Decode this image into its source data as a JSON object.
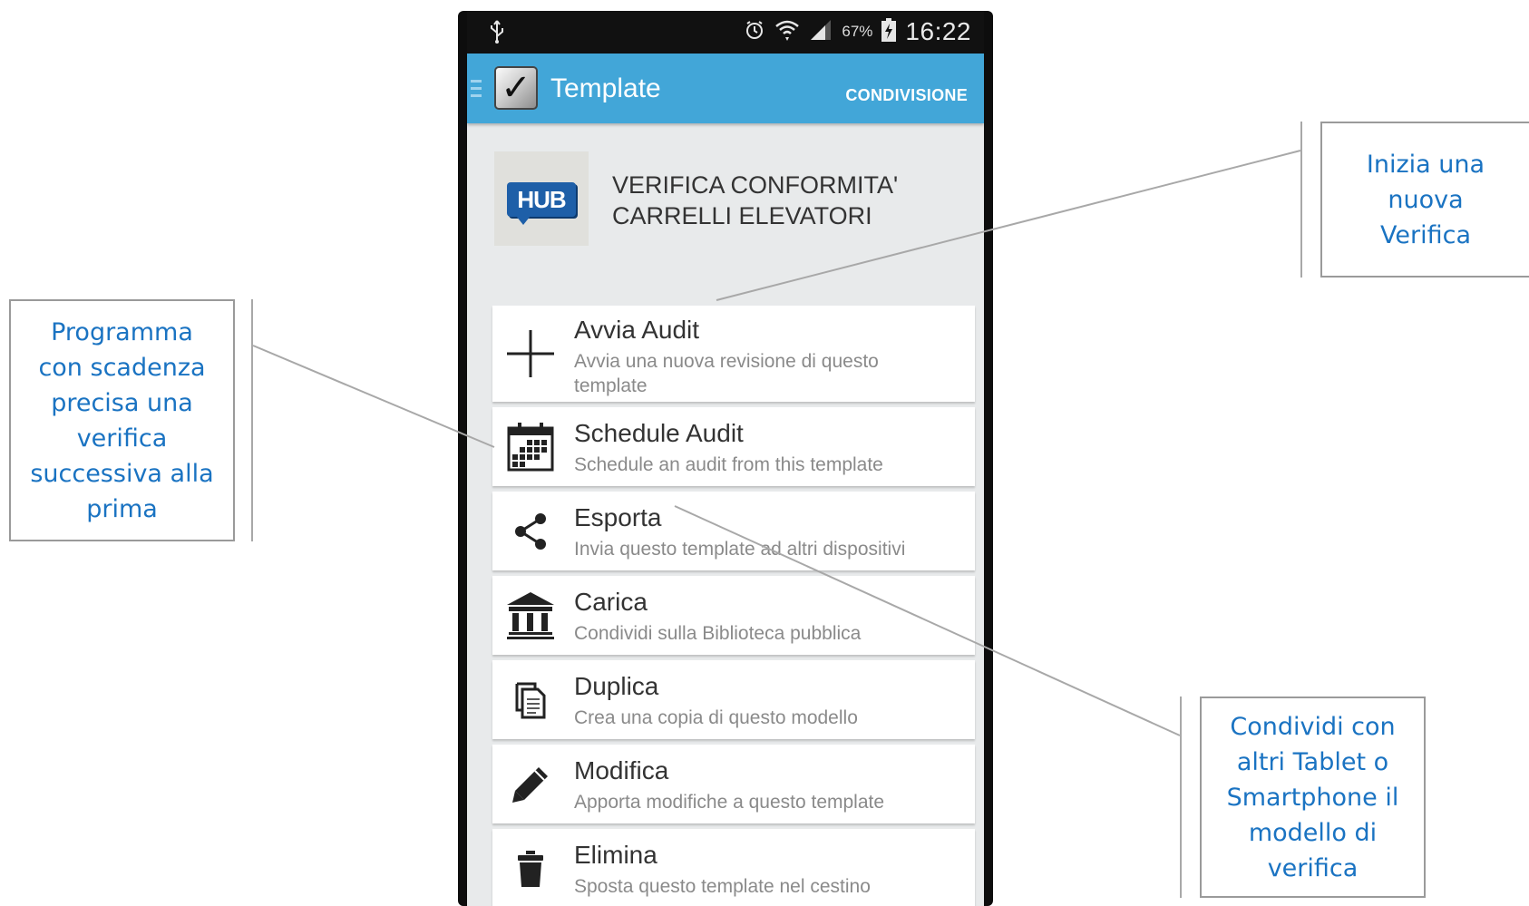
{
  "status_bar": {
    "usb_icon": "usb-icon",
    "alarm_icon": "alarm-icon",
    "wifi_icon": "wifi-icon",
    "signal_icon": "signal-icon",
    "battery_percent": "67%",
    "battery_icon": "battery-charging-icon",
    "time": "16:22"
  },
  "action_bar": {
    "title": "Template",
    "action_label": "CONDIVISIONE",
    "colors": {
      "background": "#42a6d8",
      "text": "#ffffff"
    }
  },
  "template": {
    "logo_text": "HUB",
    "name_line1": "VERIFICA CONFORMITA'",
    "name_line2": "CARRELLI ELEVATORI"
  },
  "menu": [
    {
      "icon": "plus-icon",
      "title": "Avvia Audit",
      "subtitle": "Avvia una nuova revisione di questo template"
    },
    {
      "icon": "calendar-icon",
      "title": "Schedule Audit",
      "subtitle": "Schedule an audit from this template"
    },
    {
      "icon": "share-icon",
      "title": "Esporta",
      "subtitle": "Invia questo template ad altri dispositivi"
    },
    {
      "icon": "library-icon",
      "title": "Carica",
      "subtitle": "Condividi sulla Biblioteca pubblica"
    },
    {
      "icon": "copy-icon",
      "title": "Duplica",
      "subtitle": "Crea una copia di questo modello"
    },
    {
      "icon": "pencil-icon",
      "title": "Modifica",
      "subtitle": "Apporta modifiche a questo template"
    },
    {
      "icon": "trash-icon",
      "title": "Elimina",
      "subtitle": "Sposta questo template nel cestino"
    }
  ],
  "callouts": {
    "new_audit": "Inizia una nuova Verifica",
    "schedule": "Programma con scadenza precisa una verifica successiva alla prima",
    "share": "Condividi con altri Tablet o Smartphone il modello di verifica",
    "text_color": "#1a73c2"
  }
}
